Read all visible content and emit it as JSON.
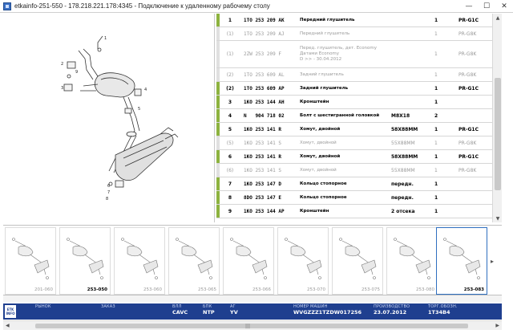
{
  "window": {
    "title": "etkainfo-251-550 - 178.218.221.178:4345 - Подключение к удаленному рабочему столу",
    "minimize": "—",
    "maximize": "☐",
    "close": "✕"
  },
  "parts": [
    {
      "pos": "1",
      "num": "1TO 253 209 AK",
      "desc": "Передний глушитель",
      "spec": "",
      "qty": "1",
      "code": "PR-G1C",
      "active": true
    },
    {
      "pos": "(1)",
      "num": "1TO 253 209 AJ",
      "desc": "Передний глушитель",
      "spec": "",
      "qty": "1",
      "code": "PR-G8K",
      "active": false
    },
    {
      "pos": "(1)",
      "num": "2ZW 253 209 F",
      "desc": "Перед. глушитель, дет. Economy\nДатами Economy\nD              >>  - 30.04.2012",
      "spec": "",
      "qty": "1",
      "code": "PR-G8K",
      "active": false
    },
    {
      "pos": "(2)",
      "num": "1TO 253 609 AL",
      "desc": "Задний глушитель",
      "spec": "",
      "qty": "1",
      "code": "PR-G8K",
      "active": false
    },
    {
      "pos": "(2)",
      "num": "1TO 253 609 AP",
      "desc": "Задний глушитель",
      "spec": "",
      "qty": "1",
      "code": "PR-G1C",
      "active": true
    },
    {
      "pos": "3",
      "num": "1KO 253 144 AH",
      "desc": "Кронштейн",
      "spec": "",
      "qty": "1",
      "code": "",
      "active": true
    },
    {
      "pos": "4",
      "num": "N   904 718 02",
      "desc": "Болт с шестигранной головкой",
      "spec": "M8X18",
      "qty": "2",
      "code": "",
      "active": true
    },
    {
      "pos": "5",
      "num": "1KO 253 141 R",
      "desc": "Хомут, двойной",
      "spec": "58X88MM",
      "qty": "1",
      "code": "PR-G1C",
      "active": true
    },
    {
      "pos": "(5)",
      "num": "1KO 253 141 S",
      "desc": "Хомут, двойной",
      "spec": "55X88MM",
      "qty": "1",
      "code": "PR-G8K",
      "active": false
    },
    {
      "pos": "6",
      "num": "1KO 253 141 R",
      "desc": "Хомут, двойной",
      "spec": "58X88MM",
      "qty": "1",
      "code": "PR-G1C",
      "active": true
    },
    {
      "pos": "(6)",
      "num": "1KO 253 141 S",
      "desc": "Хомут, двойной",
      "spec": "55X88MM",
      "qty": "1",
      "code": "PR-G8K",
      "active": false
    },
    {
      "pos": "7",
      "num": "1KO 253 147 D",
      "desc": "Кольцо стопорное",
      "spec": "передн.",
      "qty": "1",
      "code": "",
      "active": true
    },
    {
      "pos": "8",
      "num": "8DO 253 147 E",
      "desc": "Кольцо стопорное",
      "spec": "передн.",
      "qty": "1",
      "code": "",
      "active": true
    },
    {
      "pos": "9",
      "num": "1KO 253 144 AP",
      "desc": "Кронштейн",
      "spec": "2 отсека",
      "qty": "1",
      "code": "",
      "active": true
    }
  ],
  "thumbnails": [
    {
      "label": "201-060",
      "selected": false,
      "bold": false
    },
    {
      "label": "253-050",
      "selected": false,
      "bold": true
    },
    {
      "label": "253-060",
      "selected": false,
      "bold": false
    },
    {
      "label": "253-065",
      "selected": false,
      "bold": false
    },
    {
      "label": "253-066",
      "selected": false,
      "bold": false
    },
    {
      "label": "253-070",
      "selected": false,
      "bold": false
    },
    {
      "label": "253-075",
      "selected": false,
      "bold": false
    },
    {
      "label": "253-080",
      "selected": false,
      "bold": false
    },
    {
      "label": "253-083",
      "selected": true,
      "bold": true
    }
  ],
  "infobar": {
    "logo_top": "ETK",
    "logo_bottom": "INFO",
    "fields": [
      {
        "header": "РЫНОК",
        "value": ""
      },
      {
        "header": "ЗАКАЗ",
        "value": ""
      },
      {
        "header": "ВЛЛ",
        "value": "CAVC"
      },
      {
        "header": "БПК",
        "value": "NTP"
      },
      {
        "header": "АГ",
        "value": "YV"
      },
      {
        "header": "НОМЕР МАШИН",
        "value": "WVGZZZ1TZDW017256"
      },
      {
        "header": "ПРОИЗВОДСТВО",
        "value": "23.07.2012"
      },
      {
        "header": "ТОРГ.ОБОЗН.",
        "value": "1T34B4"
      }
    ]
  },
  "diagram_callouts": [
    "1",
    "2",
    "3",
    "4",
    "5",
    "6",
    "7",
    "8",
    "9"
  ],
  "colors": {
    "accent_green": "#8db33f",
    "infobar_blue": "#1f3f8f",
    "selected_border": "#2f6fbf"
  }
}
